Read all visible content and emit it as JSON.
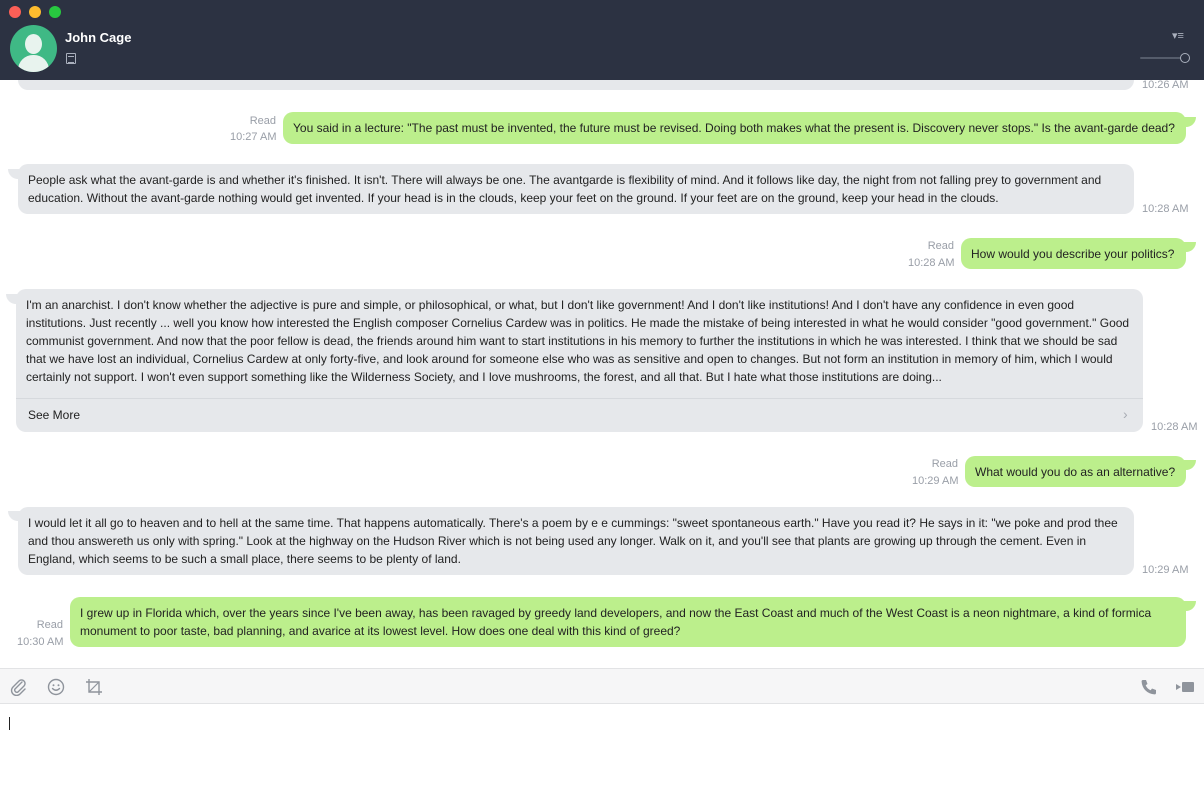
{
  "header": {
    "contact_name": "John Cage"
  },
  "icons": {
    "menu": "sort-lines-icon",
    "notes": "notes-icon",
    "attach": "paperclip-icon",
    "emoji": "smiley-icon",
    "crop": "crop-icon",
    "call": "phone-icon",
    "video": "video-camera-icon"
  },
  "colors": {
    "titlebar": "#2c3242",
    "incoming_bubble": "#e6e8eb",
    "outgoing_bubble": "#bcef8c",
    "avatar": "#3fb985"
  },
  "messages": [
    {
      "direction": "in",
      "text": "",
      "time": "10:26 AM"
    },
    {
      "direction": "out",
      "read": "Read",
      "time": "10:27 AM",
      "text": "You said in a lecture: \"The past must be invented, the future must be revised. Doing both makes what the present is. Discovery never stops.\" Is the avant-garde dead?"
    },
    {
      "direction": "in",
      "time": "10:28 AM",
      "text": "People ask what the avant-garde is and whether it's finished. It isn't. There will always be one. The avantgarde is flexibility of mind. And it follows like day, the night from not falling prey to government and education. Without the avant-garde nothing would get invented. If your head is in the clouds, keep your feet on the ground. If your feet are on the ground, keep your head in the clouds."
    },
    {
      "direction": "out",
      "read": "Read",
      "time": "10:28 AM",
      "text": "How would you describe your politics?"
    },
    {
      "direction": "in",
      "time": "10:28 AM",
      "see_more": "See More",
      "text": "I'm an anarchist. I don't know whether the adjective is pure and simple, or philosophical, or what, but I don't like government! And I don't like institutions! And I don't have any confidence in even good institutions. Just recently ... well you know how interested the English composer Cornelius Cardew was in politics. He made the mistake of being interested in what he would consider \"good government.\" Good communist government. And now that the poor fellow is dead, the friends around him want to start institutions in his memory to further the institutions in which he was interested. I think that we should be sad that we have lost an individual, Cornelius Cardew at only forty-five, and look around for someone else who was as sensitive and open to changes. But not form an institution in memory of him, which I would certainly not support. I won't even support something like the Wilderness Society, and I love mushrooms, the forest, and all that. But I hate what those institutions are doing..."
    },
    {
      "direction": "out",
      "read": "Read",
      "time": "10:29 AM",
      "text": "What would you do as an alternative?"
    },
    {
      "direction": "in",
      "time": "10:29 AM",
      "text": "I would let it all go to heaven and to hell at the same time. That happens automatically. There's a poem by e e cummings: \"sweet spontaneous earth.\" Have you read it? He says in it: \"we poke and prod thee and thou answereth us only with spring.\" Look at the highway on the Hudson River which is not being used any longer. Walk on it, and you'll see that plants are growing up through the cement. Even in England, which seems to be such a small place, there seems to be plenty of land."
    },
    {
      "direction": "out",
      "read": "Read",
      "time": "10:30 AM",
      "text": "I grew up in Florida which, over the years since I've been away, has been ravaged by greedy land developers, and now the East Coast and much of the West Coast is a neon nightmare, a kind of formica monument to poor taste, bad planning, and avarice at its lowest level. How does one deal with this kind of greed?"
    }
  ],
  "composer": {
    "value": ""
  }
}
